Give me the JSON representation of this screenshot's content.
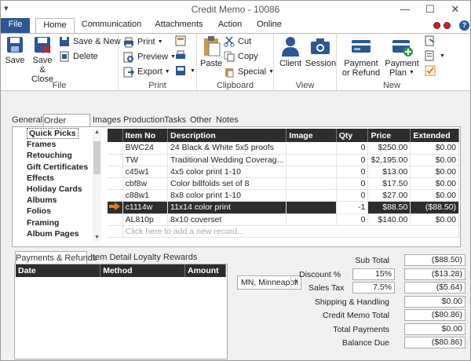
{
  "window": {
    "title": "Credit Memo - 10086"
  },
  "tabs": [
    "File",
    "Home",
    "Communication",
    "Attachments",
    "Action",
    "Online"
  ],
  "ribbon": {
    "file_group": {
      "label": "File",
      "save": "Save",
      "save_close": [
        "Save &",
        "Close"
      ],
      "save_new": "Save & New",
      "delete": "Delete"
    },
    "print_group": {
      "label": "Print",
      "print": "Print",
      "preview": "Preview",
      "export": "Export"
    },
    "clipboard_group": {
      "label": "Clipboard",
      "paste": "Paste",
      "cut": "Cut",
      "copy": "Copy",
      "special": "Special"
    },
    "view_group": {
      "label": "View",
      "client": "Client",
      "session": "Session"
    },
    "new_group": {
      "label": "New",
      "payment_refund": [
        "Payment",
        "or Refund"
      ],
      "payment_plan": [
        "Payment",
        "Plan"
      ]
    }
  },
  "doc_tabs": [
    "General",
    "Order Detail",
    "Images",
    "Production",
    "Tasks",
    "Other",
    "Notes"
  ],
  "categories": [
    "Quick Picks",
    "Frames",
    "Retouching",
    "Gift Certificates",
    "Effects",
    "Holiday Cards",
    "Albums",
    "Folios",
    "Framing",
    "Album Pages"
  ],
  "grid": {
    "columns": [
      "Item No",
      "Description",
      "Image",
      "Qty",
      "Price",
      "Extended"
    ],
    "rows": [
      {
        "item": "BWC24",
        "desc": "24 Black & White 5x5 proofs",
        "image": "",
        "qty": "0",
        "price": "$250.00",
        "ext": "$0.00"
      },
      {
        "item": "TW",
        "desc": "Traditional Wedding Coverag...",
        "image": "",
        "qty": "0",
        "price": "$2,195.00",
        "ext": "$0.00"
      },
      {
        "item": "c45w1",
        "desc": "4x5 color print 1-10",
        "image": "",
        "qty": "0",
        "price": "$13.00",
        "ext": "$0.00"
      },
      {
        "item": "cbf8w",
        "desc": "Color billfolds set of 8",
        "image": "",
        "qty": "0",
        "price": "$17.50",
        "ext": "$0.00"
      },
      {
        "item": "c88w1",
        "desc": "8x8 color print 1-10",
        "image": "",
        "qty": "0",
        "price": "$27.00",
        "ext": "$0.00"
      },
      {
        "item": "c1114w",
        "desc": "11x14 color print",
        "image": "",
        "qty": "-1",
        "price": "$88.50",
        "ext": "($88.50)"
      },
      {
        "item": "AL810p",
        "desc": "8x10 coverset",
        "image": "",
        "qty": "0",
        "price": "$140.00",
        "ext": "$0.00"
      }
    ],
    "new_row": "Click here to add a new record..."
  },
  "payment_tabs": [
    "Payments & Refunds",
    "Item Detail",
    "Loyalty Rewards"
  ],
  "payment_columns": [
    "Date",
    "Method",
    "Amount"
  ],
  "location": "MN, Minneapoli",
  "totals": {
    "sub_total_label": "Sub Total",
    "sub_total": "($88.50)",
    "discount_label": "Discount %",
    "discount_pct": "15%",
    "discount": "($13.28)",
    "tax_label": "Sales Tax",
    "tax_pct": "7.5%",
    "tax": "($5.64)",
    "shipping_label": "Shipping & Handling",
    "shipping": "$0.00",
    "credit_total_label": "Credit Memo Total",
    "credit_total": "($80.86)",
    "payments_label": "Total Payments",
    "payments": "$0.00",
    "balance_label": "Balance Due",
    "balance": "($80.86)"
  }
}
